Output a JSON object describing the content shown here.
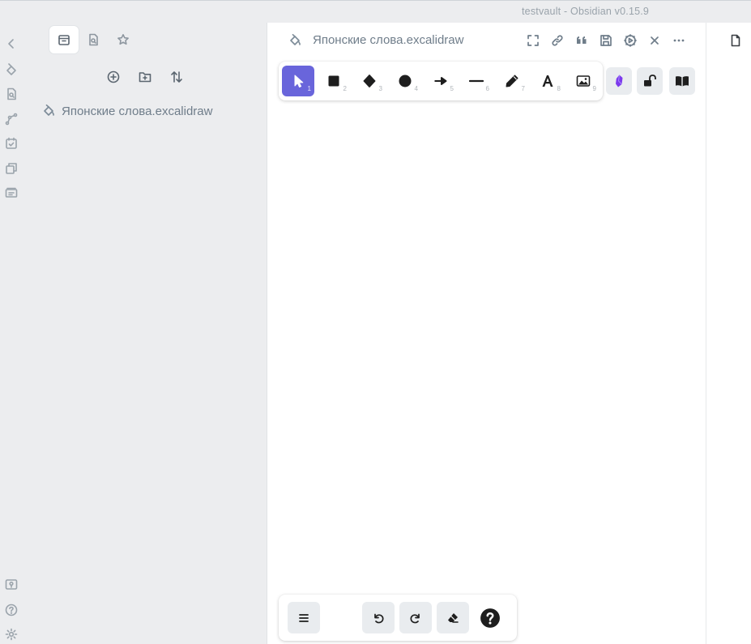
{
  "window": {
    "title": "testvault - Obsidian v0.15.9"
  },
  "ribbon": {
    "top_icons": [
      "chevron-left-icon",
      "excalidraw-icon",
      "quick-switch-icon",
      "graph-icon",
      "daily-note-icon",
      "templates-icon",
      "slides-icon"
    ],
    "bottom_icons": [
      "vault-icon",
      "help-icon",
      "settings-icon"
    ]
  },
  "sidebar": {
    "tabs": [
      "file-explorer-tab",
      "search-tab",
      "bookmarks-tab"
    ],
    "actions": [
      "new-note-icon",
      "new-folder-icon",
      "sort-icon"
    ],
    "files": [
      {
        "name": "Японские слова.excalidraw"
      }
    ]
  },
  "editor": {
    "file_title": "Японские слова.excalidraw",
    "header_actions": [
      "fullscreen-icon",
      "link-icon",
      "quote-icon",
      "save-icon",
      "script-engine-icon",
      "close-icon",
      "more-icon"
    ]
  },
  "excalidraw": {
    "tools": [
      {
        "name": "selection",
        "key": "1",
        "selected": true
      },
      {
        "name": "rectangle",
        "key": "2"
      },
      {
        "name": "diamond",
        "key": "3"
      },
      {
        "name": "ellipse",
        "key": "4"
      },
      {
        "name": "arrow",
        "key": "5"
      },
      {
        "name": "line",
        "key": "6"
      },
      {
        "name": "draw",
        "key": "7"
      },
      {
        "name": "text",
        "key": "8"
      },
      {
        "name": "image",
        "key": "9"
      }
    ],
    "accent": "#6965db",
    "extra_tools": [
      "obsidian-tools-icon",
      "unlock-icon",
      "library-icon"
    ],
    "bottom_tools": [
      "menu-icon",
      "undo-icon",
      "redo-icon",
      "eraser-icon",
      "help-icon"
    ]
  }
}
